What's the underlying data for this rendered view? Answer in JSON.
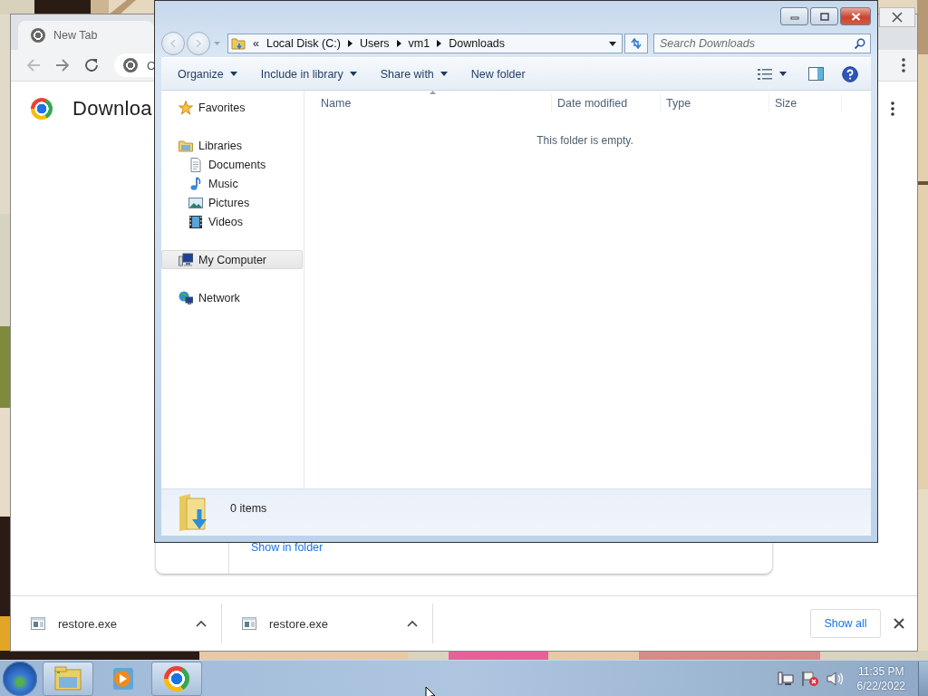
{
  "browser": {
    "tabs": [
      {
        "label": "New Tab",
        "selected": true
      }
    ],
    "omnibox": {
      "value": "C"
    },
    "page": {
      "heading": "Downloa",
      "download_card": {
        "link": "Show in folder"
      }
    },
    "download_shelf": {
      "items": [
        {
          "filename": "restore.exe"
        },
        {
          "filename": "restore.exe"
        }
      ],
      "show_all": "Show all"
    }
  },
  "explorer": {
    "address": {
      "overflow": "«",
      "segments": [
        "Local Disk (C:)",
        "Users",
        "vm1",
        "Downloads"
      ]
    },
    "search": {
      "placeholder": "Search Downloads"
    },
    "toolbar": [
      {
        "label": "Organize",
        "dropdown": true
      },
      {
        "label": "Include in library",
        "dropdown": true
      },
      {
        "label": "Share with",
        "dropdown": true
      },
      {
        "label": "New folder",
        "dropdown": false
      }
    ],
    "navigation": [
      {
        "label": "Favorites",
        "kind": "favorites",
        "selected": false
      },
      {
        "label": "Libraries",
        "kind": "libraries",
        "selected": false,
        "children": [
          {
            "label": "Documents",
            "kind": "documents",
            "selected": false
          },
          {
            "label": "Music",
            "kind": "music",
            "selected": false
          },
          {
            "label": "Pictures",
            "kind": "pictures",
            "selected": false
          },
          {
            "label": "Videos",
            "kind": "videos",
            "selected": false
          }
        ]
      },
      {
        "label": "My Computer",
        "kind": "computer",
        "selected": true
      },
      {
        "label": "Network",
        "kind": "network",
        "selected": false
      }
    ],
    "columns": [
      "Name",
      "Date modified",
      "Type",
      "Size"
    ],
    "empty_message": "This folder is empty.",
    "status": "0 items"
  },
  "taskbar": {
    "buttons": [
      {
        "kind": "explorer",
        "running": true
      },
      {
        "kind": "media",
        "running": false
      },
      {
        "kind": "chrome",
        "running": true
      }
    ],
    "clock": {
      "time": "11:35 PM",
      "date": "6/22/2022"
    }
  }
}
